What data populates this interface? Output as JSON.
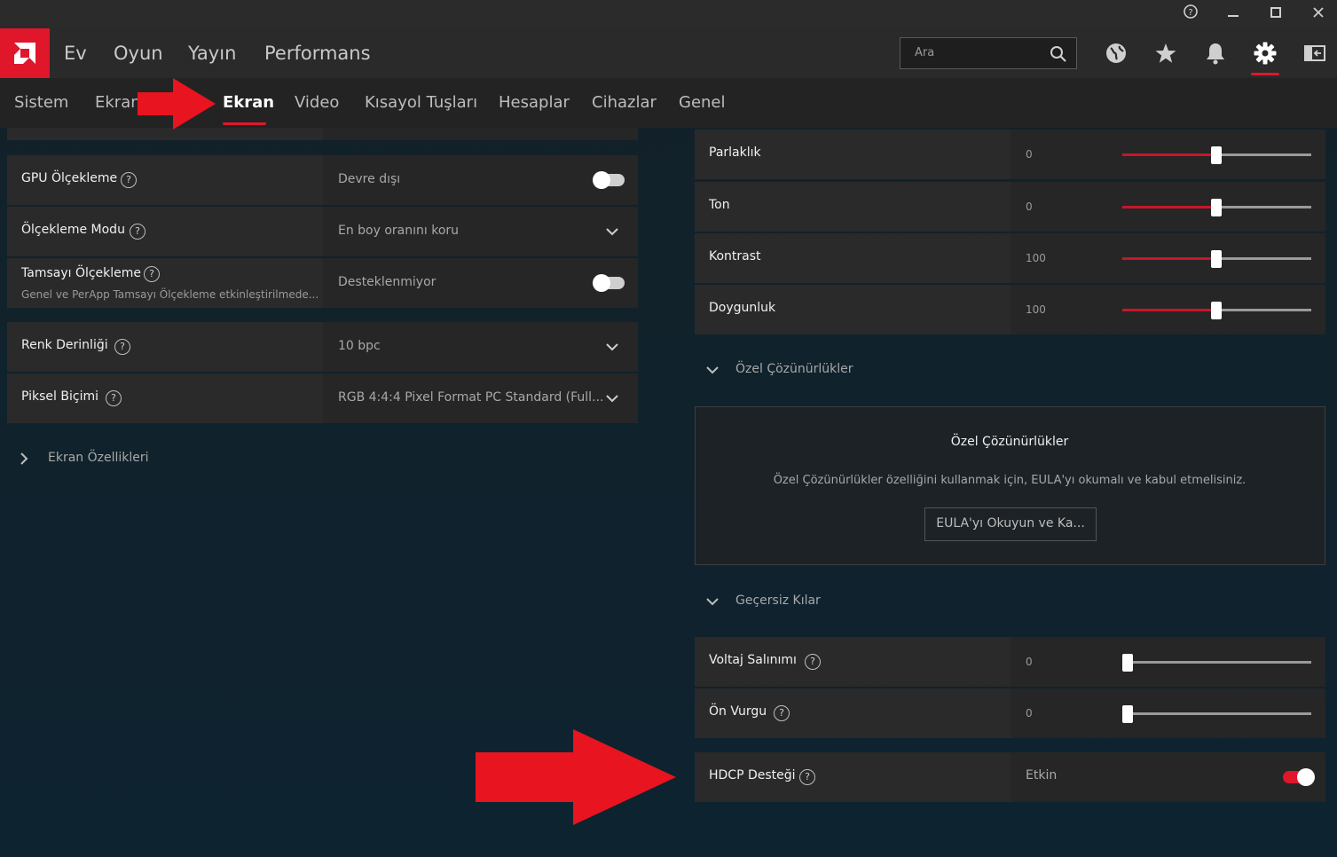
{
  "window": {
    "help": "?",
    "minimize": "—",
    "maximize": "▢",
    "close": "✕"
  },
  "nav": {
    "items": [
      "Ev",
      "Oyun",
      "Yayın",
      "Performans"
    ],
    "search_placeholder": "Ara"
  },
  "tabs": {
    "items": [
      "Sistem",
      "Ekran",
      "Ekran",
      "Video",
      "Kısayol Tuşları",
      "Hesaplar",
      "Cihazlar",
      "Genel"
    ],
    "active_index": 2
  },
  "left": {
    "gpu_scaling": {
      "label": "GPU Ölçekleme",
      "value": "Devre dışı",
      "enabled": false
    },
    "scaling_mode": {
      "label": "Ölçekleme Modu",
      "value": "En boy oranını koru"
    },
    "integer_scaling": {
      "label": "Tamsayı Ölçekleme",
      "sublabel": "Genel ve PerApp Tamsayı Ölçekleme etkinleştirilmede...",
      "value": "Desteklenmiyor",
      "enabled": false
    },
    "color_depth": {
      "label": "Renk Derinliği",
      "value": "10 bpc"
    },
    "pixel_format": {
      "label": "Piksel Biçimi",
      "value": "RGB 4:4:4 Pixel Format PC Standard (Full..."
    },
    "display_props": "Ekran Özellikleri"
  },
  "right": {
    "color": [
      {
        "label": "Parlaklık",
        "value": "0",
        "position": 0.5
      },
      {
        "label": "Ton",
        "value": "0",
        "position": 0.5
      },
      {
        "label": "Kontrast",
        "value": "100",
        "position": 0.5
      },
      {
        "label": "Doygunluk",
        "value": "100",
        "position": 0.5
      }
    ],
    "custom_res_section": "Özel Çözünürlükler",
    "eula": {
      "title": "Özel Çözünürlükler",
      "text": "Özel Çözünürlükler özelliğini kullanmak için, EULA'yı okumalı ve kabul etmelisiniz.",
      "button": "EULA'yı Okuyun ve Ka..."
    },
    "override_section": "Geçersiz Kılar",
    "override": [
      {
        "label": "Voltaj Salınımı",
        "value": "0",
        "position": 0
      },
      {
        "label": "Ön Vurgu",
        "value": "0",
        "position": 0
      }
    ],
    "hdcp": {
      "label": "HDCP Desteği",
      "value": "Etkin",
      "enabled": true
    }
  },
  "colors": {
    "accent": "#e0162b",
    "arrow": "#e8141f"
  }
}
